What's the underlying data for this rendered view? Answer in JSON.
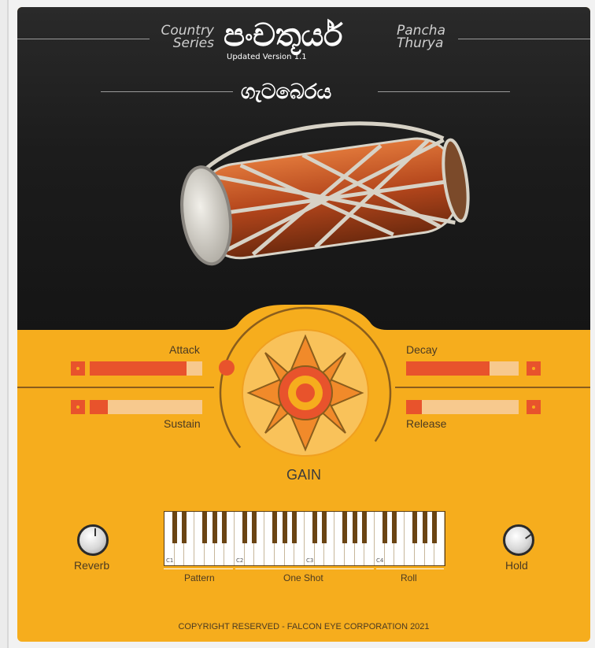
{
  "header": {
    "series_left_1": "Country",
    "series_left_2": "Series",
    "main_title": "පංචතූර්ය",
    "version": "Updated Version 1.1",
    "series_right_1": "Pancha",
    "series_right_2": "Thurya",
    "instrument_title": "ගැටබෙරය"
  },
  "envelope": {
    "attack": {
      "label": "Attack",
      "value": 0.86
    },
    "decay": {
      "label": "Decay",
      "value": 0.74
    },
    "sustain": {
      "label": "Sustain",
      "value": 0.16
    },
    "release": {
      "label": "Release",
      "value": 0.14
    }
  },
  "gain": {
    "label": "GAIN"
  },
  "piano": {
    "octave_labels": [
      "C1",
      "C2",
      "C3",
      "C4"
    ],
    "segments": [
      {
        "label": "Pattern"
      },
      {
        "label": "One Shot"
      },
      {
        "label": "Roll"
      }
    ]
  },
  "knobs": {
    "reverb": {
      "label": "Reverb",
      "value": 0.5
    },
    "hold": {
      "label": "Hold",
      "value": 0.7
    }
  },
  "footer": {
    "copyright": "COPYRIGHT RESERVED - FALCON EYE CORPORATION 2021"
  },
  "colors": {
    "accent": "#e8532c",
    "panel": "#f6ad1d",
    "dark": "#1c1c1c"
  }
}
